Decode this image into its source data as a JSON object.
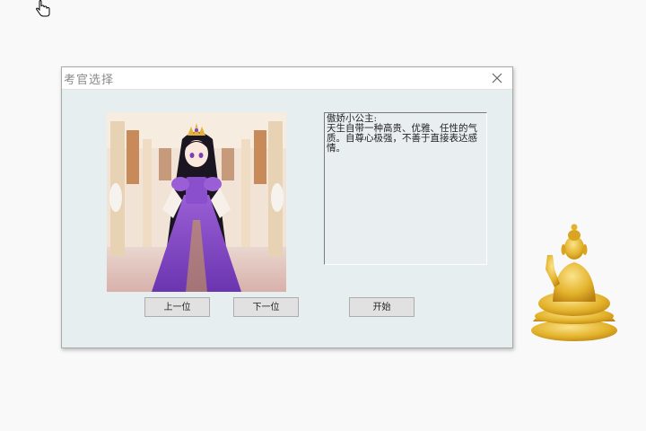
{
  "window": {
    "title": "考官选择",
    "close_icon": "close-icon"
  },
  "portrait": {
    "icon": "princess-portrait-image"
  },
  "description": {
    "text": "傲娇小公主:\n天生自带一种高贵、优雅、任性的气质。自尊心极强，不善于直接表达感情。"
  },
  "buttons": {
    "prev_label": "上一位",
    "next_label": "下一位",
    "start_label": "开始"
  },
  "decor": {
    "buddha_icon": "buddha-statue-image",
    "cursor_icon": "hand-cursor-icon"
  },
  "colors": {
    "dialog_bg": "#e7eef0",
    "accent_purple": "#7b3fb8",
    "gold": "#e3b22a"
  }
}
